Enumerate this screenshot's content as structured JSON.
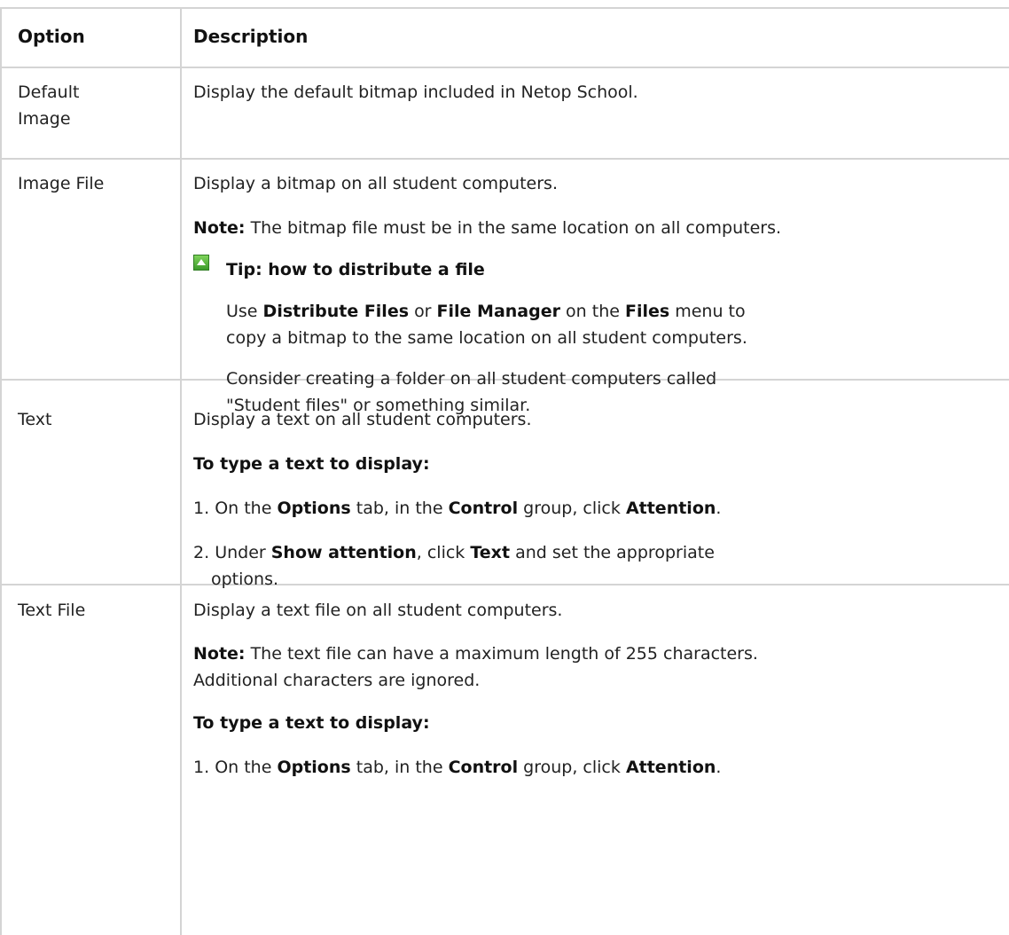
{
  "header": {
    "option": "Option",
    "description": "Description"
  },
  "rows": {
    "default_image": {
      "option_line1": "Default",
      "option_line2": "Image",
      "desc": "Display the default bitmap included in Netop School."
    },
    "image_file": {
      "option": "Image File",
      "desc": "Display a bitmap on all student computers.",
      "note_label": "Note:",
      "note_text": "The bitmap file must be in the same location on all computers.",
      "tip_title": "Tip: how to distribute a file",
      "tip_p1": {
        "use": "Use",
        "distribute_files": "Distribute Files",
        "or": "or",
        "file_manager": "File Manager",
        "on_the": "on the",
        "files": "Files",
        "menu_to": "menu to",
        "line2": "copy a bitmap to the same location on all student computers."
      },
      "tip_p2_line1": "Consider creating a folder on all student computers called",
      "tip_p2_line2": "\"Student files\" or something similar."
    },
    "text": {
      "option": "Text",
      "desc": "Display a text on all student computers.",
      "subheading": "To type a text to display:",
      "step1": {
        "num": "1.",
        "on_the": "On the",
        "options": "Options",
        "tab_in_the": "tab, in the",
        "control": "Control",
        "group_click": "group, click",
        "attention": "Attention",
        "end": "."
      },
      "step2": {
        "num": "2.",
        "under": "Under",
        "show_attention": "Show attention",
        "click": ", click",
        "text": "Text",
        "rest": "and set the appropriate",
        "line2": "options."
      }
    },
    "text_file": {
      "option": "Text File",
      "desc": "Display a text file on all student computers.",
      "note_label": "Note:",
      "note_line1": "The text file can have a maximum length of 255 characters.",
      "note_line2": "Additional characters are ignored.",
      "subheading": "To type a text to display:",
      "step1": {
        "num": "1.",
        "on_the": "On the",
        "options": "Options",
        "tab_in_the": "tab, in the",
        "control": "Control",
        "group_click": "group, click",
        "attention": "Attention",
        "end": "."
      }
    }
  },
  "colors": {
    "border": "#d4d4d4",
    "text": "#222222",
    "tip_icon": "#4caf2f"
  }
}
